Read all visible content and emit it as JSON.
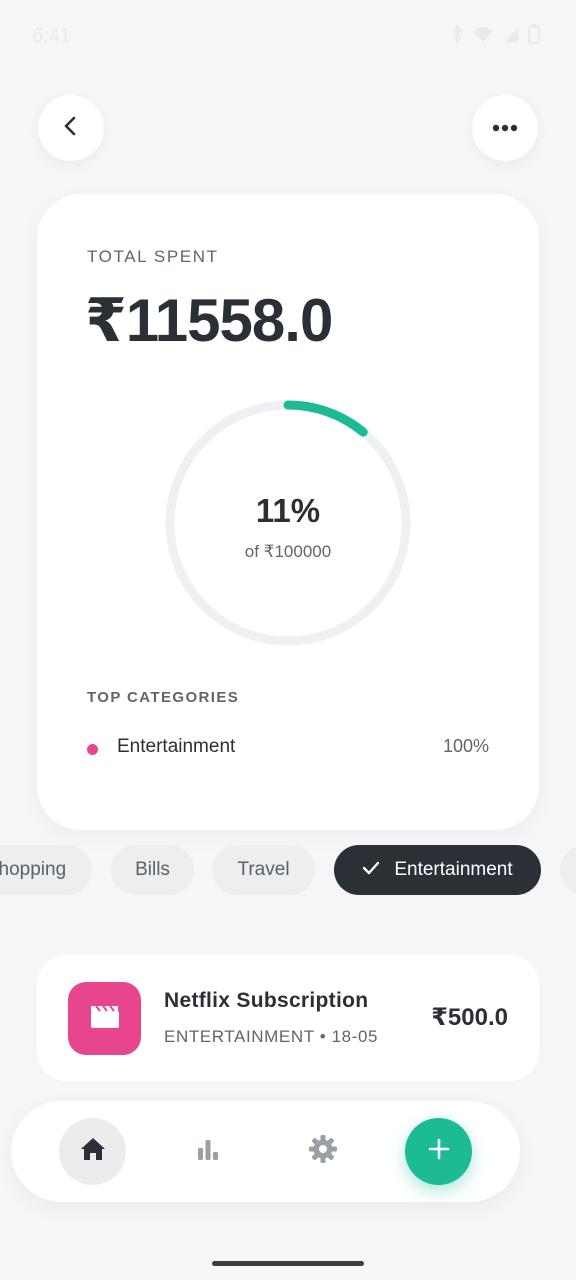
{
  "status_bar": {
    "time": "6:41"
  },
  "header": {
    "back_icon": "chevron-left-icon",
    "more_icon": "more-horizontal-icon"
  },
  "summary": {
    "total_label": "TOTAL SPENT",
    "total_amount": "₹11558.0",
    "percent_text": "11%",
    "percent_value": 0.11,
    "of_text": "of ₹100000",
    "progress_color": "#1dbb94",
    "top_categories_label": "TOP CATEGORIES",
    "categories": [
      {
        "name": "Entertainment",
        "percent": "100%",
        "color": "#e7468e"
      }
    ]
  },
  "filters": {
    "chips": [
      {
        "label": "Shopping",
        "selected": false
      },
      {
        "label": "Bills",
        "selected": false
      },
      {
        "label": "Travel",
        "selected": false
      },
      {
        "label": "Entertainment",
        "selected": true
      }
    ]
  },
  "transactions": [
    {
      "title": "Netflix Subscription",
      "subtitle": "ENTERTAINMENT • 18-05",
      "amount": "₹500.0",
      "icon": "clapperboard-icon",
      "icon_color": "#e7468e"
    }
  ],
  "nav": {
    "items": [
      {
        "icon": "home-icon",
        "active": true
      },
      {
        "icon": "bar-chart-icon",
        "active": false
      },
      {
        "icon": "gear-icon",
        "active": false
      },
      {
        "icon": "plus-icon",
        "active": false
      }
    ],
    "accent": "#1dbb94"
  }
}
